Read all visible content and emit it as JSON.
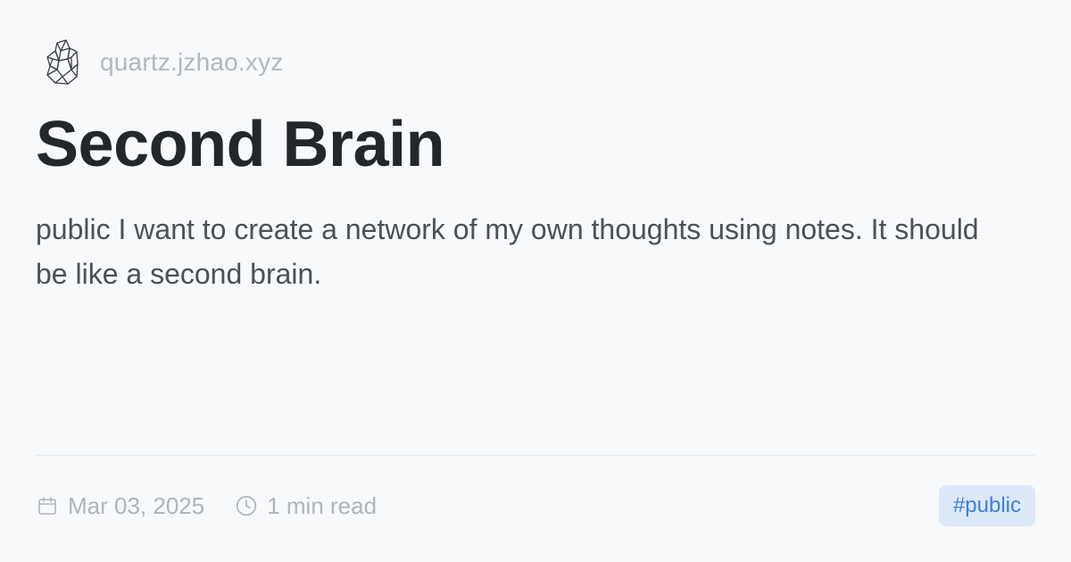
{
  "header": {
    "logo_icon": "crystal-logo-icon",
    "site_name": "quartz.jzhao.xyz"
  },
  "main": {
    "title": "Second Brain",
    "description": "public I want to create a network of my own thoughts using notes. It should be like a second brain."
  },
  "footer": {
    "date_icon": "calendar-icon",
    "date": "Mar 03, 2025",
    "read_time_icon": "clock-icon",
    "read_time": "1 min read",
    "tag": "#public"
  },
  "colors": {
    "background": "#f7f9fb",
    "title": "#23262b",
    "body_text": "#4c5058",
    "muted_text": "#b0b4bb",
    "tag_background": "#dde8f8",
    "tag_text": "#3d7fd9"
  }
}
